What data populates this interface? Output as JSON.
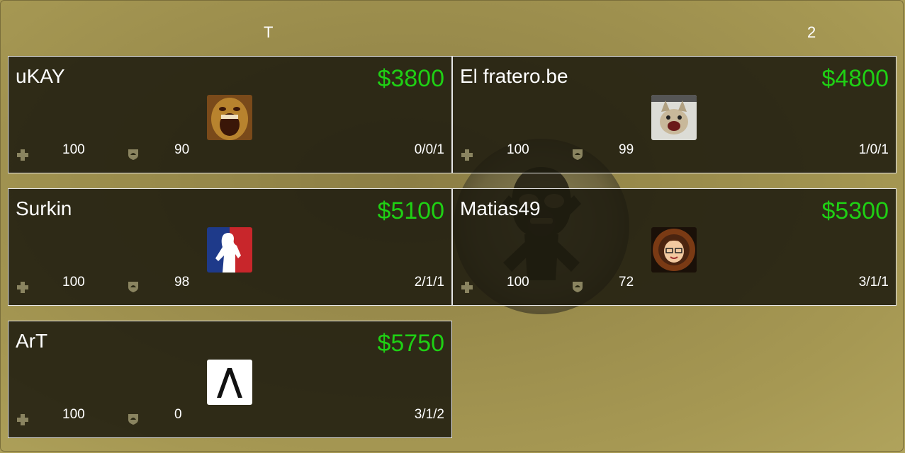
{
  "header": {
    "team_label": "T",
    "score_label": "2"
  },
  "players": [
    {
      "name": "uKAY",
      "money": "$3800",
      "health": "100",
      "armor": "90",
      "kda": "0/0/1",
      "avatar": "screaming-mask-avatar"
    },
    {
      "name": "El fratero.be",
      "money": "$4800",
      "health": "100",
      "armor": "99",
      "kda": "1/0/1",
      "avatar": "angry-cat-avatar"
    },
    {
      "name": "Surkin",
      "money": "$5100",
      "health": "100",
      "armor": "98",
      "kda": "2/1/1",
      "avatar": "league-logo-avatar"
    },
    {
      "name": "Matias49",
      "money": "$5300",
      "health": "100",
      "armor": "72",
      "kda": "3/1/1",
      "avatar": "cartoon-face-avatar"
    },
    {
      "name": "ArT",
      "money": "$5750",
      "health": "100",
      "armor": "0",
      "kda": "3/1/2",
      "avatar": "lambda-avatar"
    }
  ],
  "colors": {
    "money": "#1fd014",
    "card_bg": "#1c1a0e",
    "page_bg": "#9a8c4c"
  }
}
